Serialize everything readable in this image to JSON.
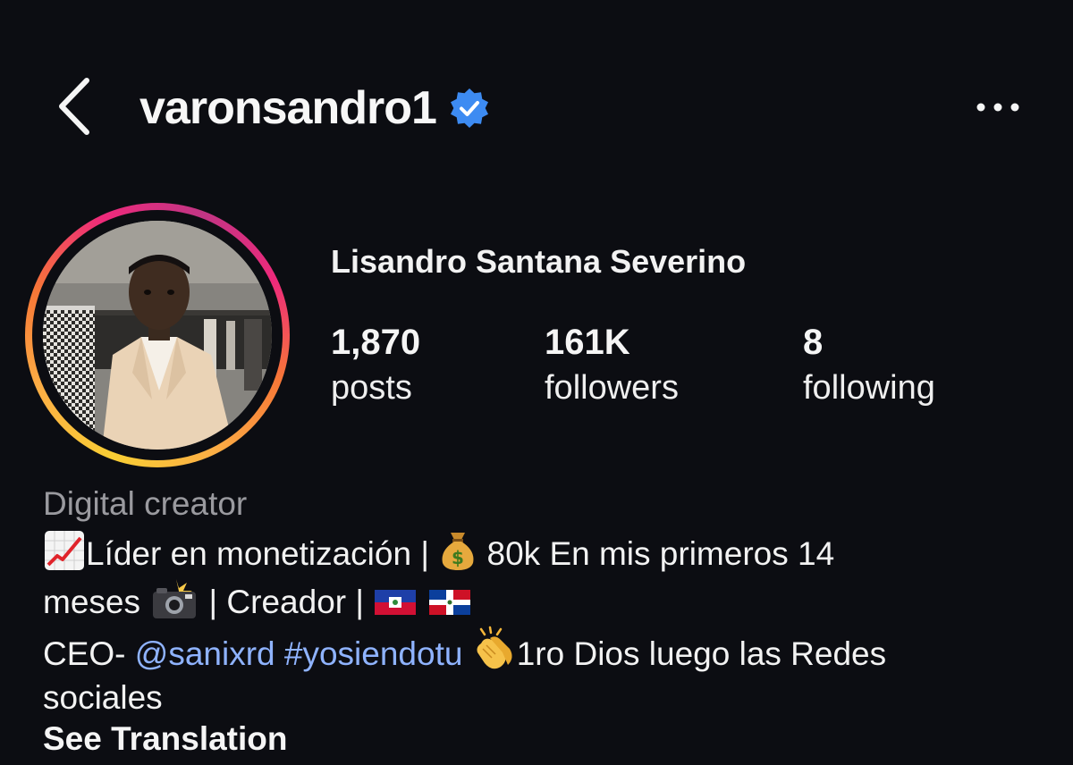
{
  "header": {
    "username": "varonsandro1",
    "back_icon": "chevron-left-icon",
    "verified_icon": "verified-badge-icon",
    "more_icon": "more-horizontal-icon"
  },
  "profile": {
    "full_name": "Lisandro Santana Severino",
    "avatar_ring_colors": [
      "#f9ce34",
      "#ee2a7b",
      "#c13584"
    ]
  },
  "stats": {
    "posts": {
      "value": "1,870",
      "label": "posts"
    },
    "followers": {
      "value": "161K",
      "label": "followers"
    },
    "following": {
      "value": "8",
      "label": "following"
    }
  },
  "bio": {
    "category": "Digital creator",
    "line1_part1": "Líder en monetización | ",
    "line1_part2": " 80k En mis primeros 14",
    "line2_part1": "meses ",
    "line2_part2": " | Creador | ",
    "line3_prefix": "CEO- ",
    "mention": "@sanixrd",
    "hashtag": "#yosiendotu",
    "line3_suffix": "1ro Dios luego las Redes",
    "line4": "sociales",
    "see_translation": "See Translation",
    "emoji_icons": [
      "chart-increasing-icon",
      "money-bag-icon",
      "camera-flash-icon",
      "haiti-flag-icon",
      "dominican-flag-icon",
      "clapping-hands-icon"
    ],
    "link_color": "#8fb3ff"
  },
  "theme": {
    "background": "#0c0d12",
    "text": "#f5f5f5",
    "muted": "#9a9a9f",
    "verified": "#3d8bf2"
  }
}
